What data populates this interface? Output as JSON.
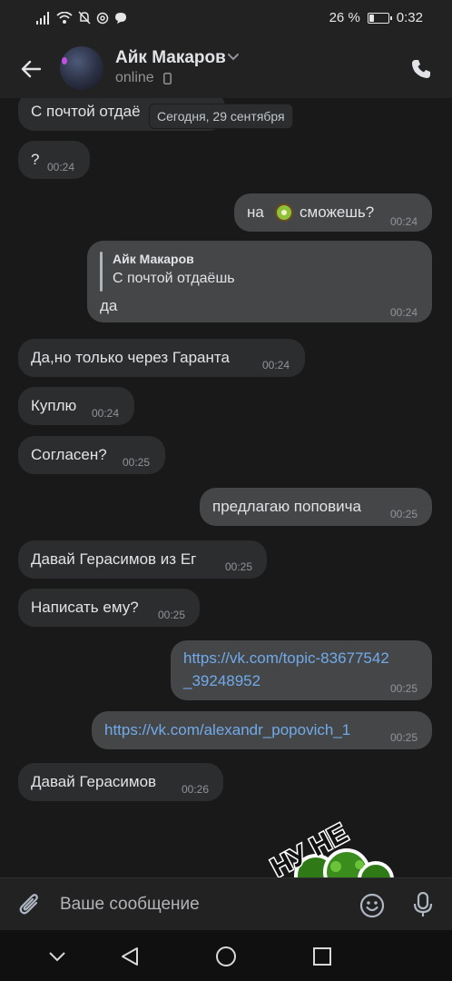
{
  "status_bar": {
    "battery": "26 %",
    "battery_level": 0.26,
    "time": "0:32",
    "icons": [
      "signal-icon",
      "wifi-icon",
      "mute-icon",
      "at-icon",
      "chat-bubble-icon"
    ]
  },
  "header": {
    "contact_name": "Айк Макаров",
    "status": "online"
  },
  "date_label": "Сегодня, 29 сентября",
  "messages": [
    {
      "text": "С почтой отдаё",
      "time": "",
      "dir": "in"
    },
    {
      "text": "?",
      "time": "00:24",
      "dir": "in"
    },
    {
      "text_before": "на",
      "emoji": "kiwi",
      "text_after": "сможешь?",
      "time": "00:24",
      "dir": "out"
    },
    {
      "reply_author": "Айк Макаров",
      "reply_text": "С почтой отдаёшь",
      "text": "да",
      "time": "00:24",
      "dir": "out"
    },
    {
      "text": "Да,но только через Гаранта",
      "time": "00:24",
      "dir": "in"
    },
    {
      "text": "Куплю",
      "time": "00:24",
      "dir": "in"
    },
    {
      "text": "Согласен?",
      "time": "00:25",
      "dir": "in"
    },
    {
      "text": "предлагаю поповича",
      "time": "00:25",
      "dir": "out"
    },
    {
      "text": "Давай Герасимов из Ег",
      "time": "00:25",
      "dir": "in"
    },
    {
      "text": "Написать ему?",
      "time": "00:25",
      "dir": "in"
    },
    {
      "line1": "https://vk.com/topic-83677542",
      "line2": "_39248952",
      "time": "00:25",
      "dir": "out"
    },
    {
      "text": "https://vk.com/alexandr_popovich_1",
      "time": "00:25",
      "dir": "out"
    },
    {
      "text": "Давай Герасимов",
      "time": "00:26",
      "dir": "in"
    }
  ],
  "sticker": {
    "text": "НУ НЕ"
  },
  "composer": {
    "placeholder": "Ваше сообщение"
  },
  "colors": {
    "background": "#19191a",
    "bubble_in": "#2c2d2e",
    "bubble_out": "#454647",
    "link": "#71aaeb"
  }
}
